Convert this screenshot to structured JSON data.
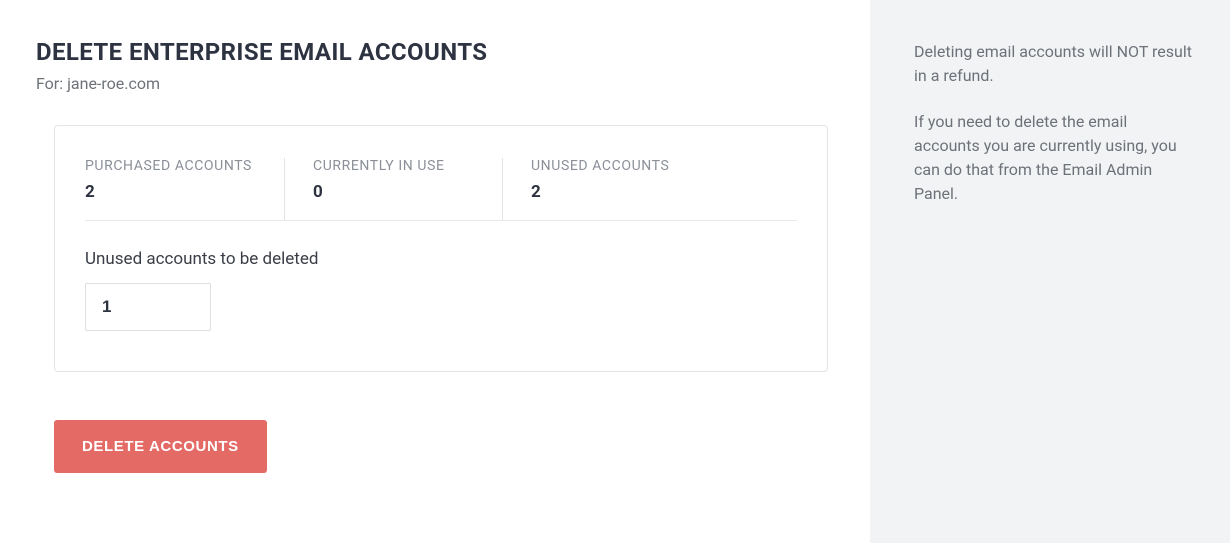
{
  "header": {
    "title": "DELETE ENTERPRISE EMAIL ACCOUNTS",
    "for_label": "For: jane-roe.com"
  },
  "stats": {
    "purchased": {
      "label": "PURCHASED ACCOUNTS",
      "value": "2"
    },
    "in_use": {
      "label": "CURRENTLY IN USE",
      "value": "0"
    },
    "unused": {
      "label": "UNUSED ACCOUNTS",
      "value": "2"
    }
  },
  "form": {
    "delete_count_label": "Unused accounts to be deleted",
    "delete_count_value": "1"
  },
  "actions": {
    "delete_button": "DELETE ACCOUNTS"
  },
  "sidebar": {
    "p1": "Deleting email accounts will NOT result in a refund.",
    "p2": "If you need to delete the email accounts you are currently using, you can do that from the Email Admin Panel."
  },
  "colors": {
    "danger": "#e46a66",
    "text_muted": "#6d7279",
    "border": "#e1e4e8"
  }
}
